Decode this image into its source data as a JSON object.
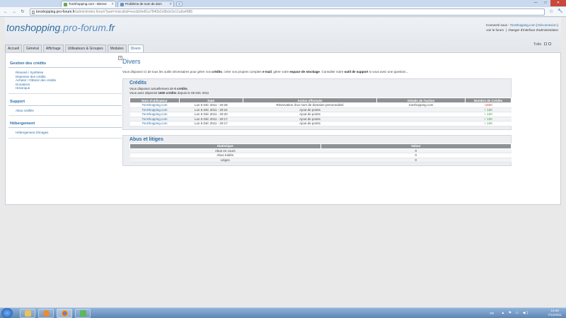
{
  "browser": {
    "tabs": [
      {
        "title": "TonShopping.com - Bienve"
      },
      {
        "title": "Problème de nom de dom"
      }
    ],
    "new_tab": "+",
    "url_host": "tonshopping.pro-forum.fr",
    "url_path": "/admin/index.forum?part=misc&tid=eecbb9e81a7840b2c8bcb2e11a9a4886",
    "back": "←",
    "forward": "→",
    "reload": "↻",
    "star": "☆",
    "wrench": "🔧",
    "min": "—",
    "max": "□",
    "close": "✕"
  },
  "site": {
    "logo_main": "tonshopping",
    "logo_sub": ".pro-forum.",
    "logo_tld": "fr",
    "connected_prefix": "Connecté sous :",
    "user": "TonShopping.com",
    "logout": "Déconnexion",
    "view_forum": "voir le forum",
    "change_interface": "changer d'interface d'administration",
    "toile_label": "Toile"
  },
  "nav": {
    "tabs": [
      "Accueil",
      "Général",
      "Affichage",
      "Utilisateurs & Groupes",
      "Modules",
      "Divers"
    ],
    "active": "Divers"
  },
  "sidebar": {
    "collapse": "«",
    "sections": [
      {
        "title": "Gestion des crédits",
        "items": [
          "Résumé / Synthèse",
          "Dépenser des crédits",
          "Acheter / Obtenir des crédits",
          "Donations",
          "Historique"
        ]
      },
      {
        "title": "Support",
        "items": [
          "Abus notifiés"
        ]
      },
      {
        "title": "Hébergement",
        "items": [
          "Hébergement d'images"
        ]
      }
    ]
  },
  "main": {
    "title": "Divers",
    "intro_1": "Vous disposez ici de tous les outils nécessaires pour gérer vos ",
    "intro_credits": "crédits",
    "intro_2": ", créer vos propres comptes ",
    "intro_email": "e-mail",
    "intro_3": ", gérer votre ",
    "intro_storage": "espace de stockage",
    "intro_4": ". Consulter notre ",
    "intro_support": "outil de support",
    "intro_5": " si vous avez une question...",
    "credits": {
      "title": "Crédits",
      "info_1_prefix": "Vous disposez actuellement de ",
      "info_1_value": "0 crédits",
      "info_1_suffix": ".",
      "info_2_prefix": "Vous avez dépensé ",
      "info_2_value": "1600 crédits",
      "info_2_suffix": " depuis le 05 Déc 2011",
      "columns": [
        "Nom d'utilisateur",
        "Date",
        "Action effectuée",
        "Détails de l'action",
        "Nombre de Crédits"
      ],
      "rows": [
        {
          "user": "TonShopping.com",
          "date": "Lun 5 Déc 2011 - 20:28",
          "action": "Réservation d'un nom de domaine personnalisé",
          "details": "tonshopping.com",
          "credits": "-1600",
          "sign": "neg"
        },
        {
          "user": "TonShopping.com",
          "date": "Lun 5 Déc 2011 - 20:24",
          "action": "Ajout de points",
          "details": "",
          "credits": "+ 100",
          "sign": "pos"
        },
        {
          "user": "TonShopping.com",
          "date": "Lun 5 Déc 2011 - 20:20",
          "action": "Ajout de points",
          "details": "",
          "credits": "+ 100",
          "sign": "pos"
        },
        {
          "user": "TonShopping.com",
          "date": "Lun 5 Déc 2011 - 20:17",
          "action": "Ajout de points",
          "details": "",
          "credits": "+ 100",
          "sign": "pos"
        },
        {
          "user": "TonShopping.com",
          "date": "Lun 5 Déc 2011 - 20:17",
          "action": "Ajout de points",
          "details": "",
          "credits": "+ 100",
          "sign": "pos"
        }
      ]
    },
    "abuse": {
      "title": "Abus et litiges",
      "columns": [
        "Statistique",
        "Valeur"
      ],
      "rows": [
        {
          "stat": "Abus en cours",
          "value": "0"
        },
        {
          "stat": "Abus traités",
          "value": "0"
        },
        {
          "stat": "Litiges",
          "value": "0"
        }
      ]
    }
  },
  "taskbar": {
    "lang": "FR",
    "tray_icons": "▲ ⚑ ▭ ◀)",
    "time": "13:49",
    "date": "7/12/2011"
  },
  "colors": {
    "accent": "#2e6da4",
    "negative": "#d04444",
    "positive": "#3a9a3a"
  }
}
